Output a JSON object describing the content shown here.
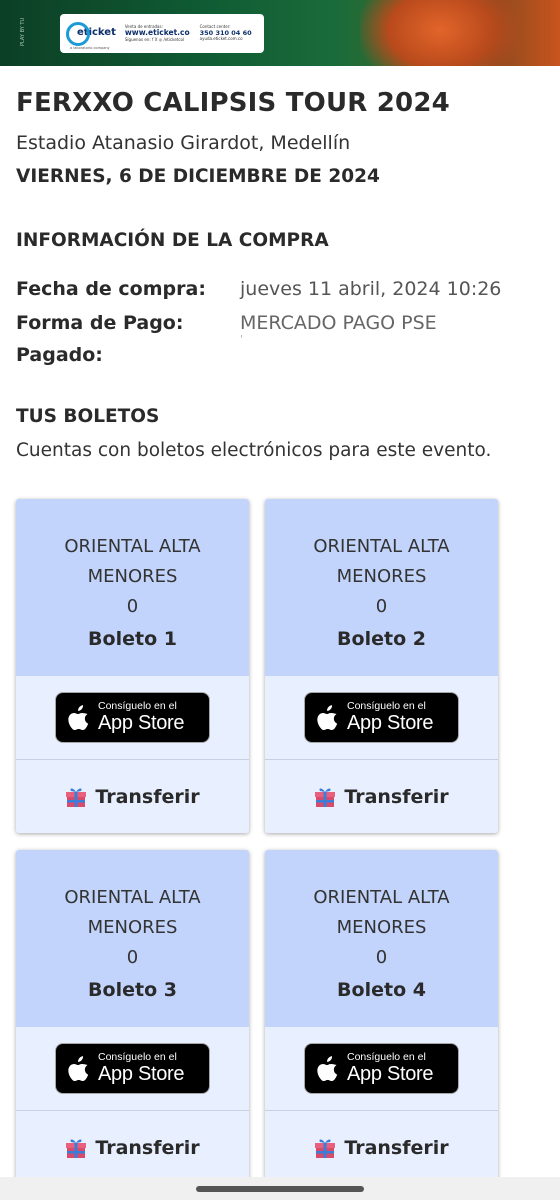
{
  "banner": {
    "side_text": "PLAY BY TU",
    "logo_text": "eticket",
    "logo_sub": "a laboratorio company",
    "sales_caption": "Venta de entradas:",
    "sales_url": "www.eticket.co",
    "social_caption": "Síguenos en: f X ◎ /eticketcol",
    "contact_caption": "Contact center:",
    "contact_phone": "350 310 04 60",
    "help_url": "ayuda.eticket.com.co"
  },
  "event": {
    "title": "FERXXO CALIPSIS TOUR 2024",
    "venue": "Estadio Atanasio Girardot, Medellín",
    "date": "VIERNES, 6 DE DICIEMBRE DE 2024"
  },
  "purchase": {
    "section_title": "INFORMACIÓN DE LA COMPRA",
    "rows": [
      {
        "label": "Fecha de compra:",
        "value": "jueves 11 abril, 2024 10:26"
      },
      {
        "label": "Forma de Pago:",
        "value": "MERCADO PAGO PSE"
      },
      {
        "label": "Pagado:",
        "value": "'"
      }
    ]
  },
  "tickets_section": {
    "title": "TUS BOLETOS",
    "subtitle": "Cuentas con boletos electrónicos para este evento."
  },
  "tickets": [
    {
      "zone": "ORIENTAL ALTA",
      "category": "MENORES",
      "number": "0",
      "label": "Boleto 1",
      "store_small": "Consíguelo en el",
      "store_big": "App Store",
      "transfer": "Transferir"
    },
    {
      "zone": "ORIENTAL ALTA",
      "category": "MENORES",
      "number": "0",
      "label": "Boleto 2",
      "store_small": "Consíguelo en el",
      "store_big": "App Store",
      "transfer": "Transferir"
    },
    {
      "zone": "ORIENTAL ALTA",
      "category": "MENORES",
      "number": "0",
      "label": "Boleto 3",
      "store_small": "Consíguelo en el",
      "store_big": "App Store",
      "transfer": "Transferir"
    },
    {
      "zone": "ORIENTAL ALTA",
      "category": "MENORES",
      "number": "0",
      "label": "Boleto 4",
      "store_small": "Consíguelo en el",
      "store_big": "App Store",
      "transfer": "Transferir"
    }
  ],
  "colors": {
    "ticket_header": "#c2d4fb",
    "ticket_body": "#e8efff",
    "banner_green": "#0f5a33",
    "banner_orange": "#c8541e"
  },
  "icons": {
    "apple": "apple-logo-icon",
    "gift": "gift-icon"
  }
}
